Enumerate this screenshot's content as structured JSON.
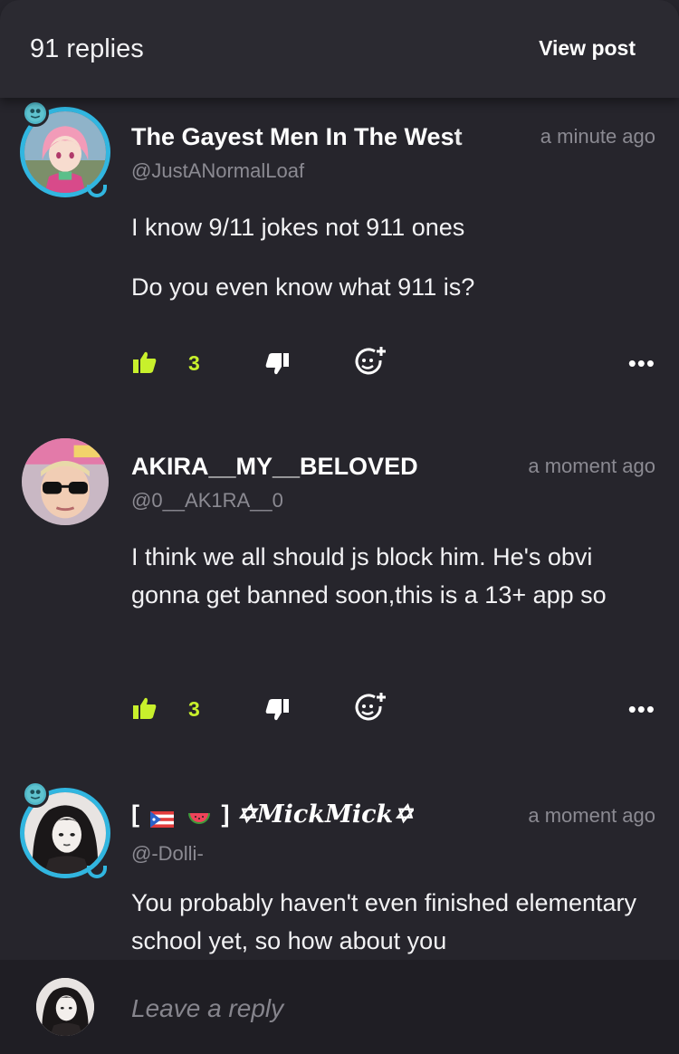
{
  "header": {
    "reply_count": "91 replies",
    "view_post_label": "View post"
  },
  "comments": [
    {
      "username": "The Gayest Men In The West",
      "handle": "@JustANormalLoaf",
      "time": "a minute ago",
      "body": [
        "I know 9/11 jokes not 911 ones",
        "Do you even know what 911 is?"
      ],
      "likes": "3"
    },
    {
      "username": "AKIRA__MY__BELOVED",
      "handle": "@0__AK1RA__0",
      "time": "a moment ago",
      "body": [
        "I think we all should js block him. He's obvi gonna get banned soon,this is a 13+ app so"
      ],
      "likes": "3"
    },
    {
      "username_prefix": "[",
      "username_mid": "]",
      "username_script": "✡MickMick✡",
      "handle": "@-Dolli-",
      "time": "a moment ago",
      "body": [
        "You probably haven't even finished elementary school yet, so how about you"
      ]
    }
  ],
  "icons": {
    "like": "thumbs-up-icon",
    "dislike": "thumbs-down-icon",
    "react": "add-reaction-icon",
    "more": "more-options-icon"
  },
  "more_glyph": "•••",
  "reply": {
    "placeholder": "Leave a reply"
  },
  "colors": {
    "background": "#26252c",
    "accent_green": "#c8f02c",
    "ring_blue": "#31b6e0",
    "muted_text": "#8b8a92"
  }
}
